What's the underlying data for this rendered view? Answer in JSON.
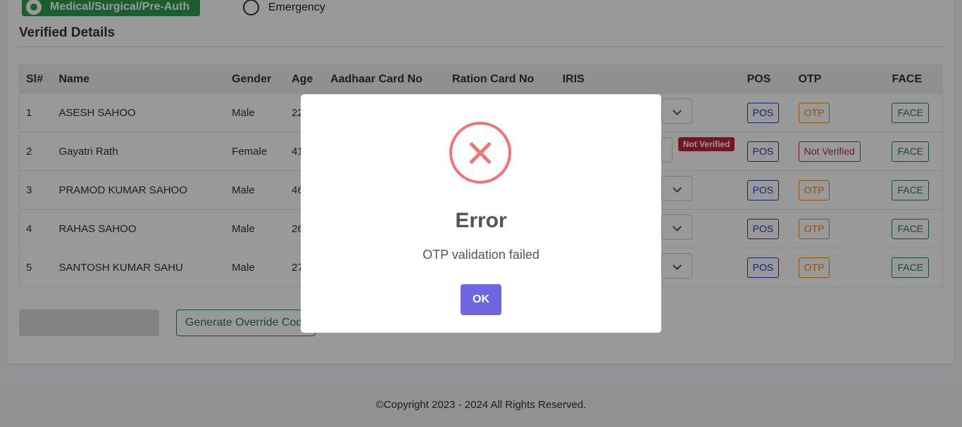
{
  "case_type": {
    "selected_label": "Medical/Surgical/Pre-Auth",
    "other_label": "Emergency"
  },
  "section_title": "Verified Details",
  "table": {
    "headers": [
      "Sl#",
      "Name",
      "Gender",
      "Age",
      "Aadhaar Card No",
      "Ration Card No",
      "IRIS",
      "POS",
      "OTP",
      "FACE"
    ],
    "rows": [
      {
        "sl": "1",
        "name": "ASESH SAHOO",
        "gender": "Male",
        "age": "22",
        "pos": "POS",
        "otp": "OTP",
        "face": "FACE"
      },
      {
        "sl": "2",
        "name": "Gayatri Rath",
        "gender": "Female",
        "age": "41",
        "iris_badge": "Not Verified",
        "pos": "POS",
        "otp": "Not Verified",
        "face": "FACE"
      },
      {
        "sl": "3",
        "name": "PRAMOD KUMAR SAHOO",
        "gender": "Male",
        "age": "46",
        "pos": "POS",
        "otp": "OTP",
        "face": "FACE"
      },
      {
        "sl": "4",
        "name": "RAHAS SAHOO",
        "gender": "Male",
        "age": "26",
        "pos": "POS",
        "otp": "OTP",
        "face": "FACE"
      },
      {
        "sl": "5",
        "name": "SANTOSH KUMAR SAHU",
        "gender": "Male",
        "age": "27",
        "pos": "POS",
        "otp": "OTP",
        "face": "FACE"
      }
    ]
  },
  "actions": {
    "generate_override_label": "Generate Override Code"
  },
  "footer": {
    "copyright": "©Copyright 2023 - 2024 All Rights Reserved."
  },
  "modal": {
    "icon": "error-x-icon",
    "title": "Error",
    "message": "OTP validation failed",
    "ok_label": "OK"
  },
  "colors": {
    "success": "#2e9c4f",
    "danger": "#c0243a",
    "modal_error": "#f27474",
    "ok_button": "#7066e0"
  }
}
